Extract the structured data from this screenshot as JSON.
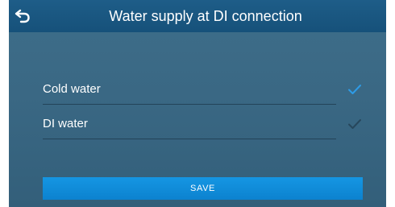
{
  "header": {
    "title": "Water supply at DI connection",
    "back_icon": "back-arrow-icon"
  },
  "options": [
    {
      "label": "Cold water",
      "selected": true
    },
    {
      "label": "DI water",
      "selected": false
    }
  ],
  "save_label": "SAVE",
  "colors": {
    "selected_check": "#2e9be6",
    "unselected_check": "#27475c",
    "save_button": "#1590dd",
    "titlebar": "#1b5883"
  }
}
